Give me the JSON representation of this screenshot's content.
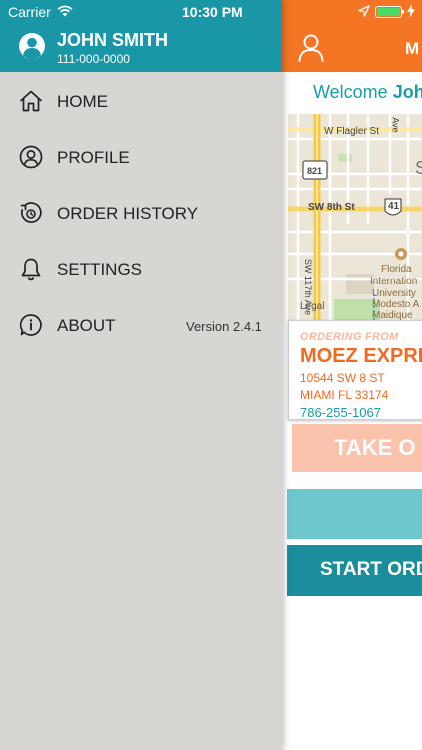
{
  "status_bar": {
    "carrier": "Carrier",
    "time": "10:30 PM"
  },
  "user": {
    "name": "JOHN SMITH",
    "phone": "111-000-0000"
  },
  "menu": [
    {
      "label": "HOME",
      "icon": "home-icon"
    },
    {
      "label": "PROFILE",
      "icon": "profile-icon"
    },
    {
      "label": "ORDER HISTORY",
      "icon": "order-history-icon"
    },
    {
      "label": "SETTINGS",
      "icon": "bell-icon"
    },
    {
      "label": "ABOUT",
      "icon": "info-icon"
    }
  ],
  "version": "Version 2.4.1",
  "main": {
    "header_title": "M",
    "welcome_prefix": "Welcome ",
    "welcome_name": "Joh",
    "map": {
      "labels": [
        "W Flagler St",
        "SW 8th St",
        "821",
        "41",
        "Florida",
        "Internation",
        "University",
        "Modesto A",
        "Maidique",
        "SW 117th Ave",
        "Ave",
        "S",
        "Legal"
      ]
    },
    "order_card": {
      "ordering_from": "ORDERING FROM",
      "store_name": "MOEZ EXPRE",
      "address_line1": "10544 SW 8 ST",
      "address_line2": "MIAMI FL 33174",
      "phone": "786-255-1067"
    },
    "take_out_label": "TAKE O",
    "start_order_label": "START ORD"
  },
  "colors": {
    "drawer_header": "#1a97a6",
    "drawer_bg": "#d7d6d3",
    "main_header": "#f47524",
    "accent_orange": "#f26a21",
    "accent_teal": "#1a9cab",
    "take_out_bg": "#fbc3ac",
    "teal_bar": "#6ec7cd",
    "start_order_bg": "#1a8e9c"
  }
}
